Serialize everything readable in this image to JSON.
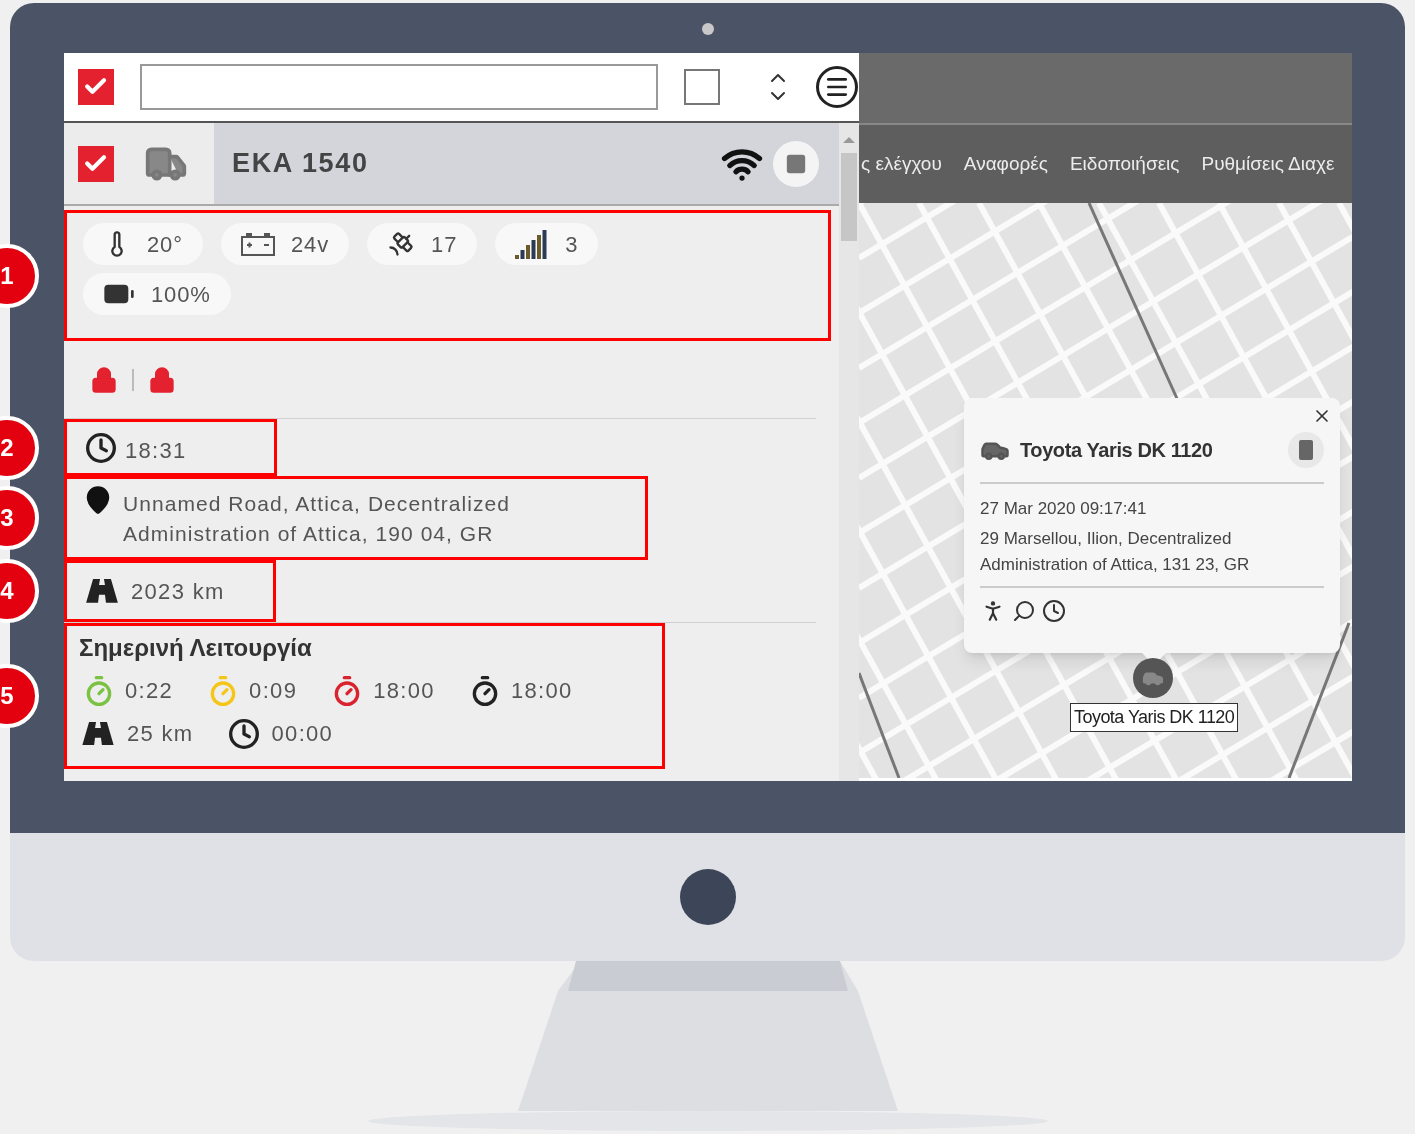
{
  "toolbar": {
    "select_all": {
      "checked": true
    },
    "view_toggle": {
      "checked": false
    }
  },
  "vehicle": {
    "checked": true,
    "name": "EKA 1540"
  },
  "sensors_section": {
    "callout": "1",
    "sensors": [
      {
        "kind": "temperature",
        "value": "20°"
      },
      {
        "kind": "voltage",
        "value": "24v"
      },
      {
        "kind": "satellites",
        "value": "17"
      },
      {
        "kind": "signal",
        "value": "3"
      },
      {
        "kind": "battery",
        "value": "100%"
      }
    ]
  },
  "locks": [
    {
      "locked": true
    },
    {
      "locked": true
    }
  ],
  "last_update": {
    "callout": "2",
    "time": "18:31"
  },
  "location": {
    "callout": "3",
    "address": "Unnamed Road, Attica, Decentralized Administration of Attica, 190 04, GR"
  },
  "odometer": {
    "callout": "4",
    "distance": "2023 km"
  },
  "today": {
    "callout": "5",
    "title": "Σημερινή Λειτουργία",
    "timers": [
      {
        "value": "0:22",
        "color": "#7cc242"
      },
      {
        "value": "0:09",
        "color": "#f5c518"
      },
      {
        "value": "18:00",
        "color": "#d9232e"
      },
      {
        "value": "18:00",
        "color": "#222222"
      }
    ],
    "distance": "25 km",
    "duration": "00:00"
  },
  "nav_tabs": [
    "ς ελέγχου",
    "Αναφορές",
    "Ειδοποιήσεις",
    "Ρυθμίσεις Διαχε"
  ],
  "map": {
    "popup": {
      "title": "Toyota Yaris DK 1120",
      "datetime": "27 Mar 2020 09:17:41",
      "address": "29 Marsellou, Ilion, Decentralized Administration of Attica, 131 23, GR"
    },
    "marker_label": "Toyota Yaris DK 1120"
  }
}
